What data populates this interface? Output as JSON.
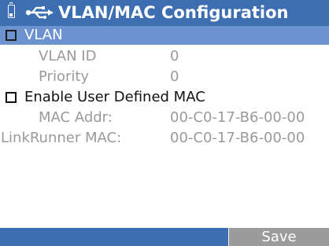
{
  "header": {
    "title": "VLAN/MAC Configuration",
    "battery_icon": "battery-icon",
    "usb_icon": "usb-link-icon"
  },
  "rows": {
    "vlan": {
      "label": "VLAN",
      "checked": false
    },
    "vlan_id": {
      "label": "VLAN ID",
      "value": "0"
    },
    "priority": {
      "label": "Priority",
      "value": "0"
    },
    "enable_mac": {
      "label": "Enable User Defined MAC",
      "checked": false
    },
    "mac_addr": {
      "label": "MAC Addr:",
      "value": "00-C0-17-B6-00-00"
    },
    "linkrunner_mac": {
      "label": "LinkRunner MAC:",
      "value": "00-C0-17-B6-00-00"
    }
  },
  "footer": {
    "save_label": "Save"
  },
  "colors": {
    "title_bar": "#3d6eb1",
    "selection": "#6c92cf",
    "disabled_text": "#9a9a9a",
    "softkey": "#9b9b9b"
  }
}
